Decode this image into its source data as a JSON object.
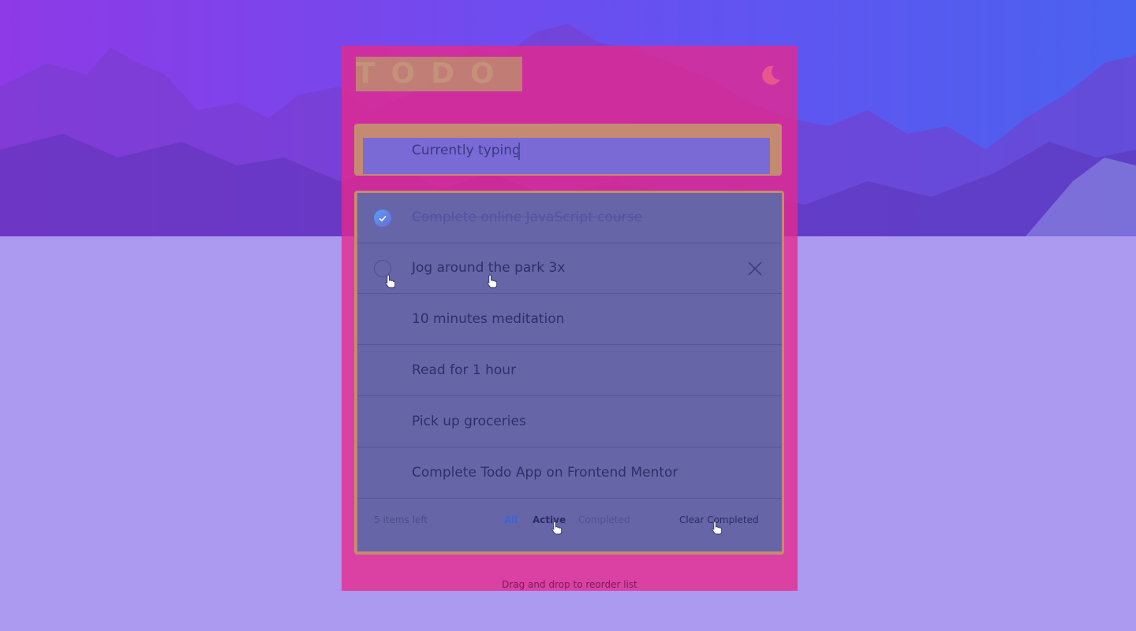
{
  "app": {
    "title": "TODO",
    "theme_toggle_icon": "moon-icon"
  },
  "input": {
    "value": "Currently typing"
  },
  "todos": [
    {
      "text": "Complete online JavaScript course",
      "completed": true
    },
    {
      "text": "Jog around the park 3x",
      "completed": false
    },
    {
      "text": "10 minutes meditation",
      "completed": false
    },
    {
      "text": "Read for 1 hour",
      "completed": false
    },
    {
      "text": "Pick up groceries",
      "completed": false
    },
    {
      "text": "Complete Todo App on Frontend Mentor",
      "completed": false
    }
  ],
  "footer": {
    "items_left": "5 items left",
    "filter_all": "All",
    "filter_active": "Active",
    "filter_completed": "Completed",
    "clear_completed": "Clear Completed"
  },
  "hint": "Drag and drop to reorder list",
  "colors": {
    "accent_blue": "#3b63d6",
    "check_gradient_start": "#5a9ef5",
    "check_gradient_end": "#6a6ad8",
    "panel_highlight": "#e8288c"
  }
}
